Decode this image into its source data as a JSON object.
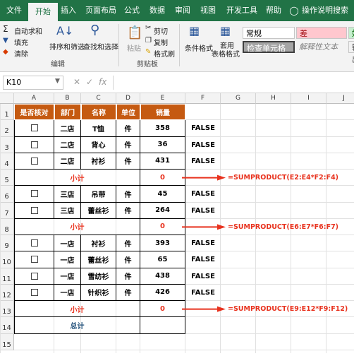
{
  "ribbon_tabs": [
    "文件",
    "开始",
    "插入",
    "页面布局",
    "公式",
    "数据",
    "审阅",
    "视图",
    "开发工具",
    "帮助",
    "操作说明搜索"
  ],
  "ribbon": {
    "autosum": "自动求和",
    "fill": "填充",
    "clear": "清除",
    "sort_filter": "排序和筛选",
    "find_select": "查找和选择",
    "group_edit": "编辑",
    "paste": "粘贴",
    "cut": "剪切",
    "copy": "复制",
    "format_painter": "格式刷",
    "group_clipboard": "剪贴板",
    "cond_format": "条件格式",
    "table_format_1": "套用",
    "table_format_2": "表格格式",
    "style_normal": "常规",
    "style_bad": "差",
    "style_check": "检查单元格",
    "style_explain": "解释性文本",
    "style_good": "好",
    "style_output": "输出"
  },
  "namebox": "K10",
  "columns": [
    "A",
    "B",
    "C",
    "D",
    "E",
    "F",
    "G",
    "H",
    "I",
    "J"
  ],
  "rows": [
    "1",
    "2",
    "3",
    "4",
    "5",
    "6",
    "7",
    "8",
    "9",
    "10",
    "11",
    "12",
    "13",
    "14",
    "15"
  ],
  "headers": [
    "是否核对",
    "部门",
    "名称",
    "单位",
    "销量"
  ],
  "data_rows": [
    {
      "dept": "二店",
      "name": "T恤",
      "unit": "件",
      "qty": "358",
      "f": "FALSE"
    },
    {
      "dept": "二店",
      "name": "背心",
      "unit": "件",
      "qty": "36",
      "f": "FALSE"
    },
    {
      "dept": "二店",
      "name": "衬衫",
      "unit": "件",
      "qty": "431",
      "f": "FALSE"
    },
    {
      "dept": "三店",
      "name": "吊带",
      "unit": "件",
      "qty": "45",
      "f": "FALSE"
    },
    {
      "dept": "三店",
      "name": "蕾丝衫",
      "unit": "件",
      "qty": "264",
      "f": "FALSE"
    },
    {
      "dept": "一店",
      "name": "衬衫",
      "unit": "件",
      "qty": "393",
      "f": "FALSE"
    },
    {
      "dept": "一店",
      "name": "蕾丝衫",
      "unit": "件",
      "qty": "65",
      "f": "FALSE"
    },
    {
      "dept": "一店",
      "name": "雪纺衫",
      "unit": "件",
      "qty": "438",
      "f": "FALSE"
    },
    {
      "dept": "一店",
      "name": "针织衫",
      "unit": "件",
      "qty": "426",
      "f": "FALSE"
    }
  ],
  "subtotal_label": "小计",
  "subtotal_value": "0",
  "total_label": "总计",
  "formulas": [
    "=SUMPRODUCT(E2:E4*F2:F4)",
    "=SUMPRODUCT(E6:E7*F6:F7)",
    "=SUMPRODUCT(E9:E12*F9:F12)"
  ],
  "colors": {
    "brand": "#217346",
    "header": "#c55a11",
    "red": "#e8321e",
    "blue": "#1f4e79"
  }
}
